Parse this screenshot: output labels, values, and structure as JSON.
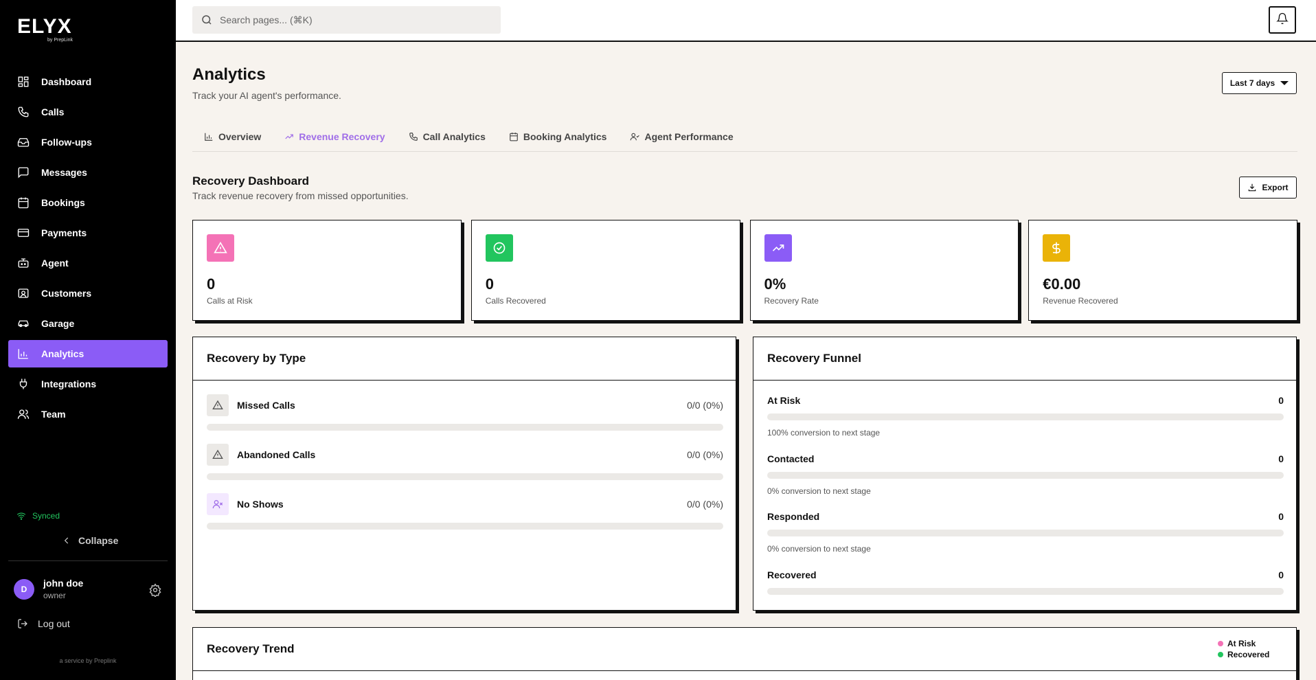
{
  "brand": {
    "name": "ELYX",
    "by": "by PrepLink"
  },
  "sidebar": {
    "items": [
      {
        "label": "Dashboard",
        "icon": "dashboard-icon",
        "active": false
      },
      {
        "label": "Calls",
        "icon": "phone-icon",
        "active": false
      },
      {
        "label": "Follow-ups",
        "icon": "inbox-icon",
        "active": false
      },
      {
        "label": "Messages",
        "icon": "message-icon",
        "active": false
      },
      {
        "label": "Bookings",
        "icon": "calendar-icon",
        "active": false
      },
      {
        "label": "Payments",
        "icon": "credit-card-icon",
        "active": false
      },
      {
        "label": "Agent",
        "icon": "bot-icon",
        "active": false
      },
      {
        "label": "Customers",
        "icon": "customers-icon",
        "active": false
      },
      {
        "label": "Garage",
        "icon": "car-icon",
        "active": false
      },
      {
        "label": "Analytics",
        "icon": "bar-chart-icon",
        "active": true
      },
      {
        "label": "Integrations",
        "icon": "plug-icon",
        "active": false
      },
      {
        "label": "Team",
        "icon": "team-icon",
        "active": false
      }
    ],
    "synced": "Synced",
    "collapse": "Collapse",
    "user": {
      "initial": "D",
      "name": "john doe",
      "role": "owner"
    },
    "logout": "Log out",
    "service": "a service by Preplink"
  },
  "search": {
    "placeholder": "Search pages... (⌘K)"
  },
  "page": {
    "title": "Analytics",
    "subtitle": "Track your AI agent's performance.",
    "range": "Last 7 days"
  },
  "tabs": [
    {
      "label": "Overview",
      "icon": "bar-chart-icon",
      "active": false
    },
    {
      "label": "Revenue Recovery",
      "icon": "trending-up-icon",
      "active": true
    },
    {
      "label": "Call Analytics",
      "icon": "phone-icon",
      "active": false
    },
    {
      "label": "Booking Analytics",
      "icon": "calendar-icon",
      "active": false
    },
    {
      "label": "Agent Performance",
      "icon": "user-icon",
      "active": false
    }
  ],
  "section": {
    "title": "Recovery Dashboard",
    "subtitle": "Track revenue recovery from missed opportunities.",
    "export": "Export"
  },
  "stats": [
    {
      "value": "0",
      "label": "Calls at Risk",
      "icon": "alert-triangle-icon",
      "color": "#f472b6"
    },
    {
      "value": "0",
      "label": "Calls Recovered",
      "icon": "check-circle-icon",
      "color": "#22c55e"
    },
    {
      "value": "0%",
      "label": "Recovery Rate",
      "icon": "trending-up-icon",
      "color": "#8b5cf6"
    },
    {
      "value": "€0.00",
      "label": "Revenue Recovered",
      "icon": "dollar-icon",
      "color": "#eab308"
    }
  ],
  "recovery_by_type": {
    "title": "Recovery by Type",
    "rows": [
      {
        "name": "Missed Calls",
        "value": "0/0 (0%)",
        "progress": 0,
        "icon": "alert-triangle-icon"
      },
      {
        "name": "Abandoned Calls",
        "value": "0/0 (0%)",
        "progress": 0,
        "icon": "alert-triangle-icon"
      },
      {
        "name": "No Shows",
        "value": "0/0 (0%)",
        "progress": 0,
        "icon": "user-x-icon"
      }
    ]
  },
  "recovery_funnel": {
    "title": "Recovery Funnel",
    "stages": [
      {
        "name": "At Risk",
        "value": "0",
        "progress": 0,
        "note": "100% conversion to next stage"
      },
      {
        "name": "Contacted",
        "value": "0",
        "progress": 0,
        "note": "0% conversion to next stage"
      },
      {
        "name": "Responded",
        "value": "0",
        "progress": 0,
        "note": "0% conversion to next stage"
      },
      {
        "name": "Recovered",
        "value": "0",
        "progress": 0,
        "note": ""
      }
    ]
  },
  "recovery_trend": {
    "title": "Recovery Trend",
    "legend": [
      {
        "label": "At Risk",
        "color": "#f472b6"
      },
      {
        "label": "Recovered",
        "color": "#22c55e"
      }
    ]
  },
  "colors": {
    "accent": "#8b5cf6",
    "accent_text": "#a06ee8",
    "sidebar_bg": "#000000",
    "page_bg": "#f7f3ee"
  }
}
